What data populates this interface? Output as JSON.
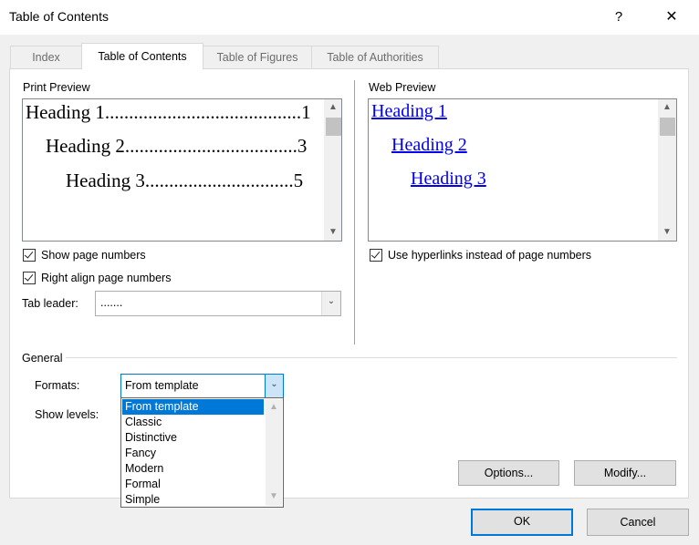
{
  "window": {
    "title": "Table of Contents",
    "help_glyph": "?",
    "close_glyph": "✕"
  },
  "tabs": [
    "Index",
    "Table of Contents",
    "Table of Figures",
    "Table of Authorities"
  ],
  "print_preview": {
    "label": "Print Preview",
    "lines": [
      "Heading 1.........................................1",
      "Heading 2....................................3",
      "Heading 3...............................5"
    ]
  },
  "web_preview": {
    "label": "Web Preview",
    "lines": [
      "Heading 1",
      "Heading 2",
      "Heading 3"
    ]
  },
  "options": {
    "show_page_numbers": {
      "label": "Show page numbers",
      "checked": true
    },
    "right_align": {
      "label": "Right align page numbers",
      "checked": true
    },
    "use_hyperlinks": {
      "label": "Use hyperlinks instead of page numbers",
      "checked": true
    },
    "tab_leader": {
      "label": "Tab leader:",
      "value": "......."
    }
  },
  "general": {
    "label": "General",
    "formats_label": "Formats:",
    "formats_value": "From template",
    "show_levels_label": "Show levels:",
    "format_options": [
      "From template",
      "Classic",
      "Distinctive",
      "Fancy",
      "Modern",
      "Formal",
      "Simple"
    ]
  },
  "buttons": {
    "options": "Options...",
    "modify": "Modify...",
    "ok": "OK",
    "cancel": "Cancel"
  },
  "icons": {
    "chevron_down": "⌄",
    "scroll_up": "▲",
    "scroll_down": "▼"
  },
  "colors": {
    "accent": "#0078d7",
    "link": "#0000ee"
  }
}
